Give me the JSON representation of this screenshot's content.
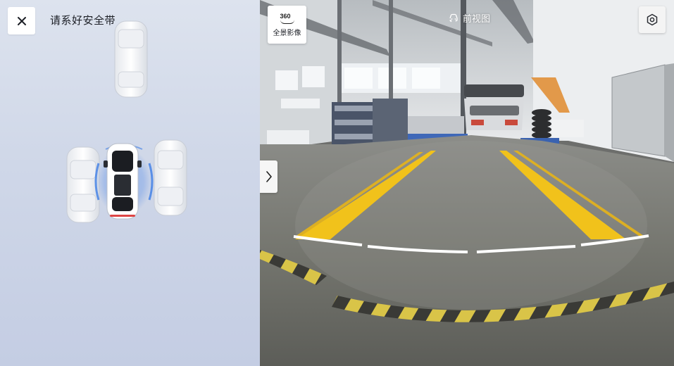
{
  "left_panel": {
    "close_icon": "close-icon",
    "status_text": "请系好安全带"
  },
  "camera": {
    "view_360": {
      "icon_text": "360",
      "label": "全景影像"
    },
    "title": {
      "icon": "car-front-icon",
      "label": "前视图"
    },
    "settings_icon": "hexagon-gear-icon",
    "expand_icon": "chevron-right-icon"
  },
  "colors": {
    "left_bg": "#cfd7e8",
    "sensor_blue": "#3c7de6",
    "lane_yellow": "#f1c21b",
    "guide_white": "#ffffff"
  }
}
